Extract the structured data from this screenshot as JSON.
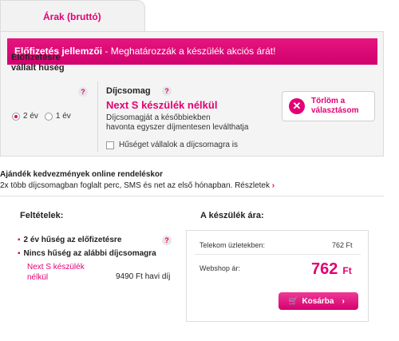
{
  "tab": {
    "label": "Árak (bruttó)"
  },
  "panel": {
    "header_bold": "Előfizetés jellemzői",
    "header_rest": " - Meghatározzák a készülék akciós árát!"
  },
  "commitment": {
    "label_line1": "Előfizetésre",
    "label_line2": "vállalt hűség",
    "help": "?",
    "options": [
      "2 év",
      "1 év"
    ],
    "selected": "2 év"
  },
  "plan": {
    "title": "Díjcsomag",
    "help": "?",
    "name": "Next S készülék nélkül",
    "description_line1": "Díjcsomagját a későbbiekben",
    "description_line2": "havonta egyszer díjmentesen leválthatja",
    "loyalty_checkbox": "Hűséget vállalok a díjcsomagra is"
  },
  "delete_button": {
    "line1": "Törlöm a",
    "line2": "választásom"
  },
  "gift": {
    "title": "Ajándék kedvezmények online rendeléskor",
    "text": "2x több díjcsomagban foglalt perc, SMS és net az első hónapban. ",
    "link": "Részletek"
  },
  "conditions": {
    "title": "Feltételek:",
    "item1": "2 év hűség az előfizetésre",
    "item2": "Nincs hűség az alábbi díjcsomagra",
    "help": "?",
    "package_line1": "Next S készülék",
    "package_line2": "nélkül",
    "package_price": "9490 Ft havi díj"
  },
  "device_price": {
    "title": "A készülék ára:",
    "store_label": "Telekom üzletekben:",
    "store_value": "762 Ft",
    "webshop_label": "Webshop ár:",
    "webshop_value": "762",
    "webshop_unit": "Ft",
    "cart_button": "Kosárba"
  },
  "colors": {
    "accent": "#e20074",
    "panel_bg": "#f4f4f4"
  }
}
